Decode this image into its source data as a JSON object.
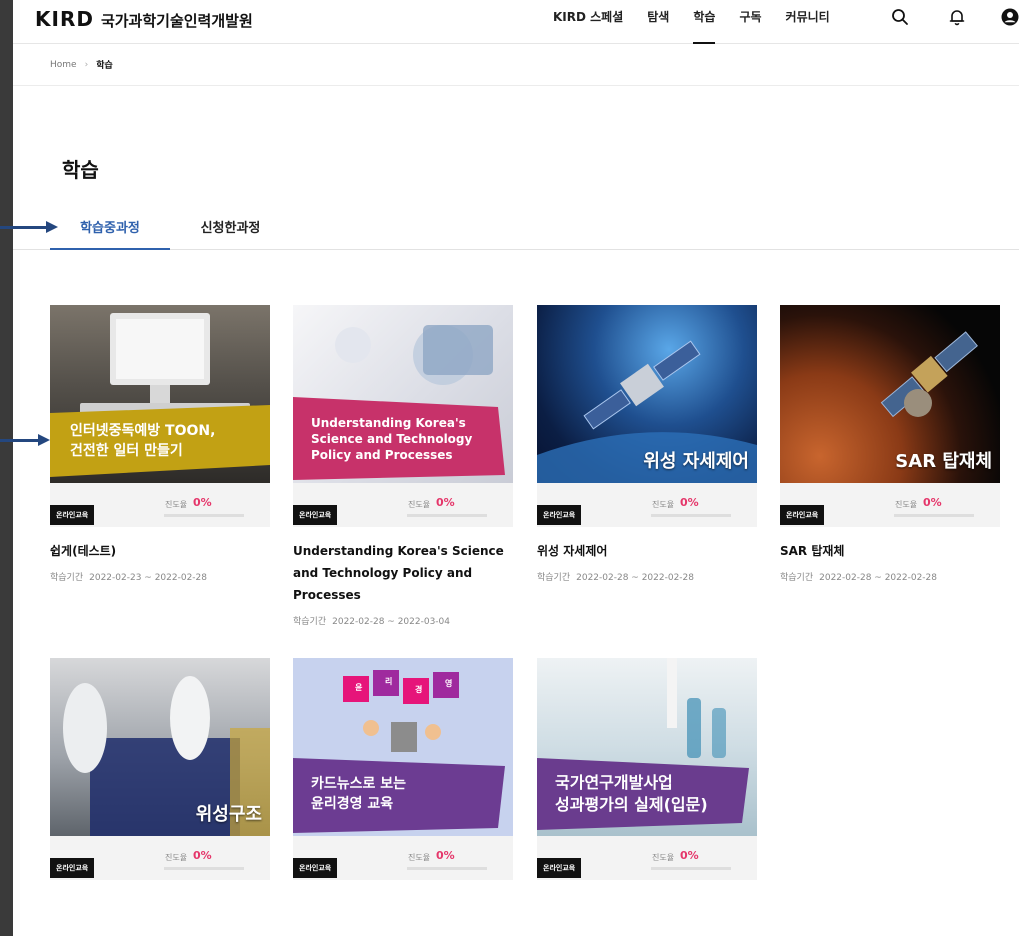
{
  "header": {
    "logo_mark": "KIRD",
    "logo_text": "국가과학기술인력개발원",
    "nav": [
      {
        "label": "KIRD 스페셜",
        "active": false
      },
      {
        "label": "탐색",
        "active": false
      },
      {
        "label": "학습",
        "active": true
      },
      {
        "label": "구독",
        "active": false
      },
      {
        "label": "커뮤니티",
        "active": false
      }
    ],
    "icons": [
      "search-icon",
      "bell-icon",
      "user-icon"
    ]
  },
  "breadcrumb": {
    "home": "Home",
    "current": "학습"
  },
  "page_title": "학습",
  "tabs": [
    {
      "label": "학습중과정",
      "active": true
    },
    {
      "label": "신청한과정",
      "active": false
    }
  ],
  "colors": {
    "accent": "#2f61ad",
    "progress": "#e5366a",
    "badge": "#111111",
    "annotation_arrow": "#24477f"
  },
  "courses": [
    {
      "thumb_text": "인터넷중독예방 TOON,\n건전한 일터 만들기",
      "badge": "온라인교육",
      "progress_label": "진도율",
      "progress": "0%",
      "title": "쉽게(테스트)",
      "period_label": "학습기간",
      "period": "2022-02-23 ~ 2022-02-28"
    },
    {
      "thumb_text": "Understanding Korea's\nScience and Technology\nPolicy and Processes",
      "badge": "온라인교육",
      "progress_label": "진도율",
      "progress": "0%",
      "title": "Understanding Korea's Science and Technology Policy and Processes",
      "period_label": "학습기간",
      "period": "2022-02-28 ~ 2022-03-04"
    },
    {
      "thumb_text": "위성 자세제어",
      "badge": "온라인교육",
      "progress_label": "진도율",
      "progress": "0%",
      "title": "위성 자세제어",
      "period_label": "학습기간",
      "period": "2022-02-28 ~ 2022-02-28"
    },
    {
      "thumb_text": "SAR 탑재체",
      "badge": "온라인교육",
      "progress_label": "진도율",
      "progress": "0%",
      "title": "SAR 탑재체",
      "period_label": "학습기간",
      "period": "2022-02-28 ~ 2022-02-28"
    },
    {
      "thumb_text": "위성구조",
      "badge": "온라인교육",
      "progress_label": "진도율",
      "progress": "0%"
    },
    {
      "thumb_text": "카드뉴스로 보는\n윤리경영 교육",
      "thumb_letters": [
        "윤",
        "리",
        "경",
        "영"
      ],
      "badge": "온라인교육",
      "progress_label": "진도율",
      "progress": "0%"
    },
    {
      "thumb_text": "국가연구개발사업\n성과평가의 실제(입문)",
      "badge": "온라인교육",
      "progress_label": "진도율",
      "progress": "0%"
    }
  ]
}
